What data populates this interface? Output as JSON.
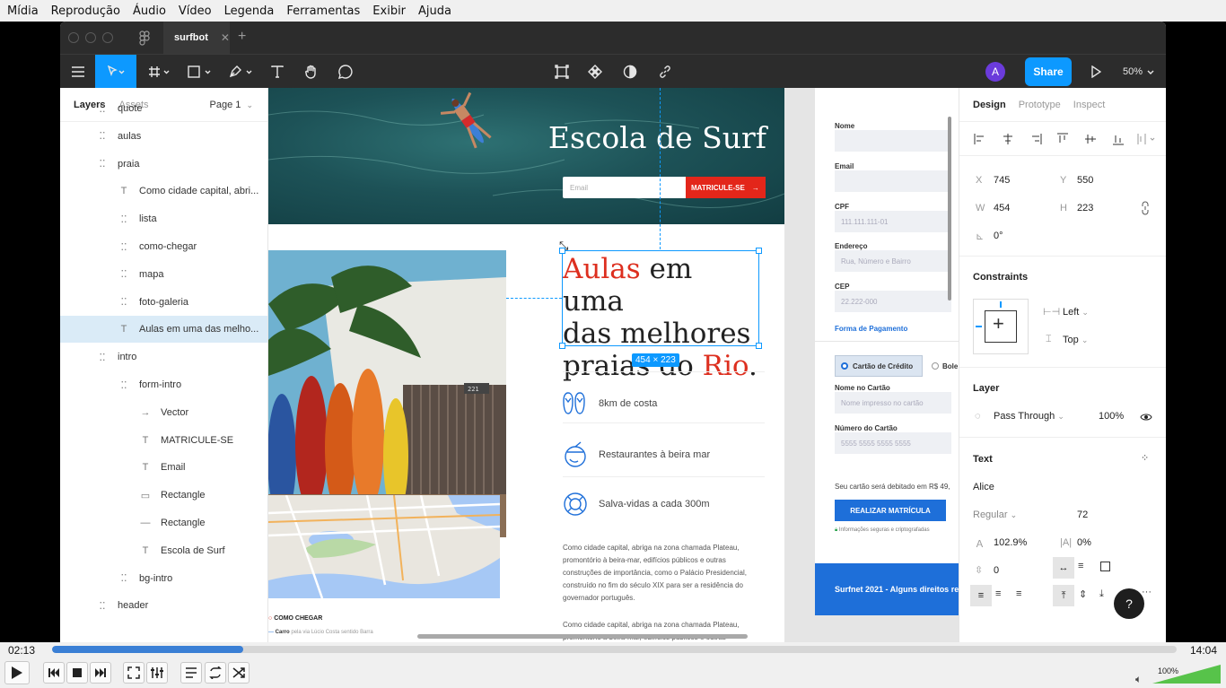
{
  "vlc": {
    "menu": [
      "Mídia",
      "Reprodução",
      "Áudio",
      "Vídeo",
      "Legenda",
      "Ferramentas",
      "Exibir",
      "Ajuda"
    ],
    "time_elapsed": "02:13",
    "time_total": "14:04",
    "progress": 0.17,
    "volume": "100%",
    "volume_level": 1.0
  },
  "figma": {
    "tab_name": "surfbot",
    "avatar": "A",
    "share": "Share",
    "zoom": "50%",
    "left_tabs": {
      "layers": "Layers",
      "assets": "Assets",
      "page": "Page 1"
    },
    "layers": [
      {
        "name": "quote",
        "icon": "frame"
      },
      {
        "name": "aulas",
        "icon": "frame"
      },
      {
        "name": "praia",
        "icon": "frame"
      },
      {
        "name": "Como cidade capital, abri...",
        "icon": "text"
      },
      {
        "name": "lista",
        "icon": "frame"
      },
      {
        "name": "como-chegar",
        "icon": "frame"
      },
      {
        "name": "mapa",
        "icon": "frame"
      },
      {
        "name": "foto-galeria",
        "icon": "frame"
      },
      {
        "name": "Aulas em uma das melho...",
        "icon": "text",
        "selected": true
      },
      {
        "name": "intro",
        "icon": "frame"
      },
      {
        "name": "form-intro",
        "icon": "frame"
      },
      {
        "name": "Vector",
        "icon": "vector"
      },
      {
        "name": "MATRICULE-SE",
        "icon": "text"
      },
      {
        "name": "Email",
        "icon": "text"
      },
      {
        "name": "Rectangle",
        "icon": "rect"
      },
      {
        "name": "Rectangle",
        "icon": "line"
      },
      {
        "name": "Escola de Surf",
        "icon": "text"
      },
      {
        "name": "bg-intro",
        "icon": "frame"
      },
      {
        "name": "header",
        "icon": "frame"
      }
    ],
    "right_tabs": {
      "design": "Design",
      "prototype": "Prototype",
      "inspect": "Inspect"
    },
    "props": {
      "x_label": "X",
      "x": "745",
      "y_label": "Y",
      "y": "550",
      "w_label": "W",
      "w": "454",
      "h_label": "H",
      "h": "223",
      "rot": "0°"
    },
    "constraints": {
      "title": "Constraints",
      "h": "Left",
      "v": "Top"
    },
    "layer": {
      "title": "Layer",
      "blend": "Pass Through",
      "opacity": "100%"
    },
    "text": {
      "title": "Text",
      "font": "Alice",
      "style": "Regular",
      "size": "72",
      "line_height": "102.9%",
      "letter": "0%",
      "para": "0"
    },
    "help": "?"
  },
  "design": {
    "hero_title": "Escola de Surf",
    "email_placeholder": "Email",
    "cta": "MATRICULE-SE",
    "heading_red_1": "Aulas",
    "heading_1": " em uma",
    "heading_2": "das melhores",
    "heading_3": "praias do ",
    "heading_red_2": "Rio",
    "heading_dot": ".",
    "size_badge": "454 × 223",
    "features": [
      "8km de costa",
      "Restaurantes à beira mar",
      "Salva-vidas a cada 300m"
    ],
    "paragraph": "Como cidade capital, abriga na zona chamada Plateau, promontório à beira-mar, edifícios públicos e outras construções de importância, como o Palácio Presidencial, construído no fim do século XIX para ser a residência do governador português.",
    "paragraph2": "Como cidade capital, abriga na zona chamada Plateau, promontório à beira-mar, edifícios públicos e outras",
    "como_chegar": "COMO CHEGAR",
    "carro": "Carro",
    "carro_desc": "pela via Lúcio Costa sentido Barra",
    "house_number": "221",
    "form": {
      "nome": "Nome",
      "email": "Email",
      "cpf": "CPF",
      "cpf_ph": "111.111.111-01",
      "endereco": "Endereço",
      "endereco_ph": "Rua, Número e Bairro",
      "cep": "CEP",
      "cep_ph": "22.222-000",
      "pagamento": "Forma de Pagamento",
      "cartao": "Cartão de Crédito",
      "boleto": "Bole",
      "nome_cartao": "Nome no Cartão",
      "nome_cartao_ph": "Nome impresso no cartão",
      "numero": "Número do Cartão",
      "numero_ph": "5555 5555 5555 5555",
      "debito": "Seu cartão será debitado em R$ 49,",
      "submit": "REALIZAR MATRÍCULA",
      "secure": "Informações seguras e criptografadas",
      "footer": "Surfnet 2021 - Alguns direitos res"
    }
  },
  "colors": {
    "accent": "#0d99ff",
    "red": "#dd2f1f",
    "cta": "#e3261a",
    "blue_button": "#1e6fd9",
    "footer": "#1e6fd9"
  }
}
